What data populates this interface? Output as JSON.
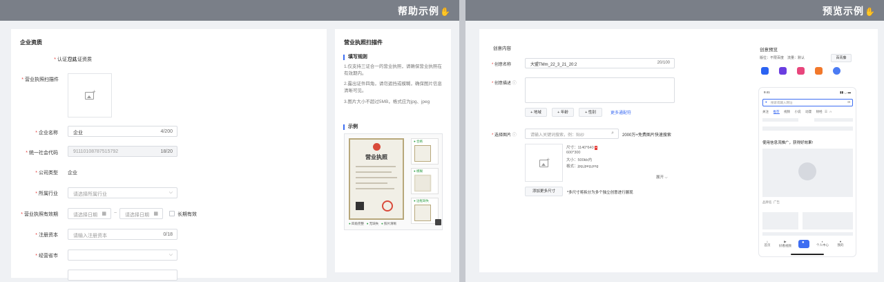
{
  "left": {
    "banner_title": "帮助示例",
    "form": {
      "title": "企业资质",
      "cert_method": {
        "label": "认证方式",
        "value": "已认证资质"
      },
      "license_scan": {
        "label": "营业执照扫描件"
      },
      "company_name": {
        "label": "企业名称",
        "value": "企业",
        "count": "4/200"
      },
      "credit_code": {
        "label": "统一社会代码",
        "value": "91110108787515792",
        "count": "18/20"
      },
      "company_type": {
        "label": "公司类型",
        "value": "企业"
      },
      "industry": {
        "label": "所属行业",
        "placeholder": "请选择所属行业"
      },
      "validity": {
        "label": "营业执照有效期",
        "start_placeholder": "请选择日期",
        "separator": "~",
        "end_placeholder": "请选择日期",
        "long_term": "长期有效"
      },
      "capital": {
        "label": "注册资本",
        "placeholder": "请输入注册资本",
        "count": "0/18"
      },
      "province": {
        "label": "经营省市"
      }
    },
    "help": {
      "title": "营业执照扫描件",
      "rules_heading": "填写规则",
      "rules": [
        "1.仅支持三证合一的营业执照，请确保营业执照在有效期内。",
        "2.露出证件四角，请勿遮挡或模糊，确保图片信息清晰可见。",
        "3.图片大小不超过5MB，格式应为jpg、jpeg"
      ],
      "example_heading": "示例",
      "license_heading": "营业执照",
      "thumb_labels": [
        "合格",
        "模糊",
        "边框缺失"
      ],
      "legend": [
        "四角完整",
        "无缺失",
        "照片清晰"
      ]
    }
  },
  "right": {
    "banner_title": "预览示例",
    "creative": {
      "title": "创意内容",
      "name": {
        "label": "创意名称",
        "value": "大盟TMm_22_3_21_20:2",
        "count": "20/100"
      },
      "desc": {
        "label": "创意描述"
      },
      "tags": [
        "+ 地域",
        "+ 年龄",
        "+ 性别"
      ],
      "more_link": "更多通配符",
      "image": {
        "label": "选择图片",
        "search_placeholder": "请输入关键词搜索，例：贴纱",
        "free_text": "2000万+免费图片快速搜索",
        "specs": [
          "尺寸：1140*640",
          "600*300",
          "大小：500kb内",
          "格式：jpg,jpeg,png"
        ],
        "expand": "展开",
        "add_button": "添加更多尺寸",
        "hint": "*多尺寸将拆分为多个独立创意进行展现"
      }
    },
    "preview": {
      "title": "创意预览",
      "position": "版位：不限百度",
      "traffic": "流量：默认",
      "toggle": "百青藤",
      "time": "9:41",
      "search_placeholder": "搜索或输入网址",
      "tabs": [
        "关注",
        "推荐",
        "视频",
        "小说",
        "动漫",
        "财经"
      ],
      "ad_text": "使用信息流推广，获得好效果!",
      "ad_label": "品牌名",
      "ad_tag": "广告",
      "nav": [
        "首页",
        "好看视频",
        "",
        "个人中心",
        "我的"
      ]
    }
  }
}
